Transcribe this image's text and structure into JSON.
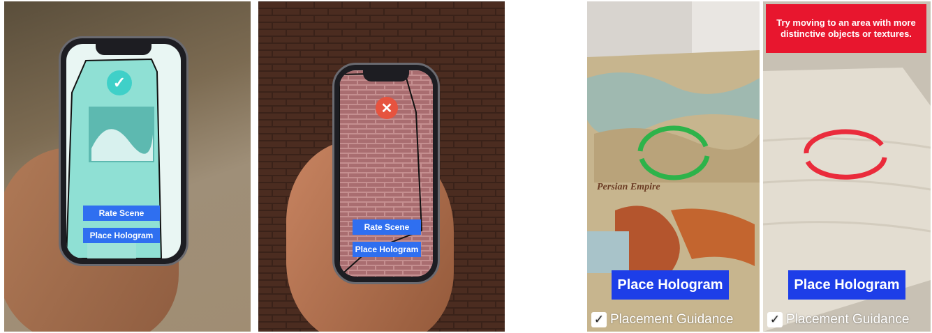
{
  "panel1": {
    "status_icon": "checkmark-icon",
    "status_color": "#3fd0c8",
    "rate_label": "Rate Scene",
    "place_label": "Place Hologram"
  },
  "panel2": {
    "status_icon": "close-icon",
    "status_color": "#e6533f",
    "rate_label": "Rate Scene",
    "place_label": "Place Hologram"
  },
  "panel3": {
    "reticle_color": "#2db34a",
    "place_label": "Place Hologram",
    "guidance_label": "Placement Guidance",
    "guidance_checked": true
  },
  "panel4": {
    "alert_text": "Try moving to an area with more distinctive objects or textures.",
    "reticle_color": "#ea2b3b",
    "place_label": "Place Hologram",
    "guidance_label": "Placement Guidance",
    "guidance_checked": true
  }
}
